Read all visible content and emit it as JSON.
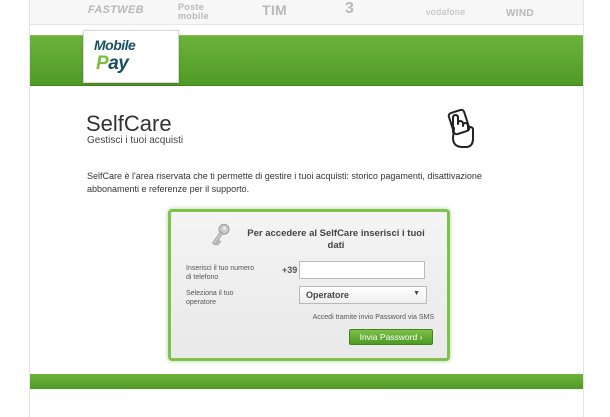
{
  "operators": {
    "fastweb": "FASTWEB",
    "poste_line1": "Poste",
    "poste_line2": "mobile",
    "tim": "TIM",
    "tre": "3",
    "vodafone": "vodafone",
    "wind": "WIND"
  },
  "brand": {
    "line1": "Mobile",
    "line2_p": "P",
    "line2_rest": "ay"
  },
  "page": {
    "title": "SelfCare",
    "subtitle": "Gestisci i tuoi acquisti",
    "description": "SelfCare è l'area riservata che ti permette di gestire i tuoi acquisti: storico pagamenti, disattivazione abbonamenti e referenze per il supporto."
  },
  "login": {
    "heading": "Per accedere al SelfCare inserisci i tuoi dati",
    "phone_label": "Inserisci il tuo numero di telefono",
    "phone_prefix": "+39",
    "phone_value": "",
    "operator_label": "Seleziona il tuo operatore",
    "operator_selected": "Operatore",
    "sms_note": "Accedi tramite invio Password via SMS",
    "send_button": "Invia Password ›"
  },
  "colors": {
    "brand_green": "#5aa52c",
    "brand_navy": "#1a4f63"
  }
}
